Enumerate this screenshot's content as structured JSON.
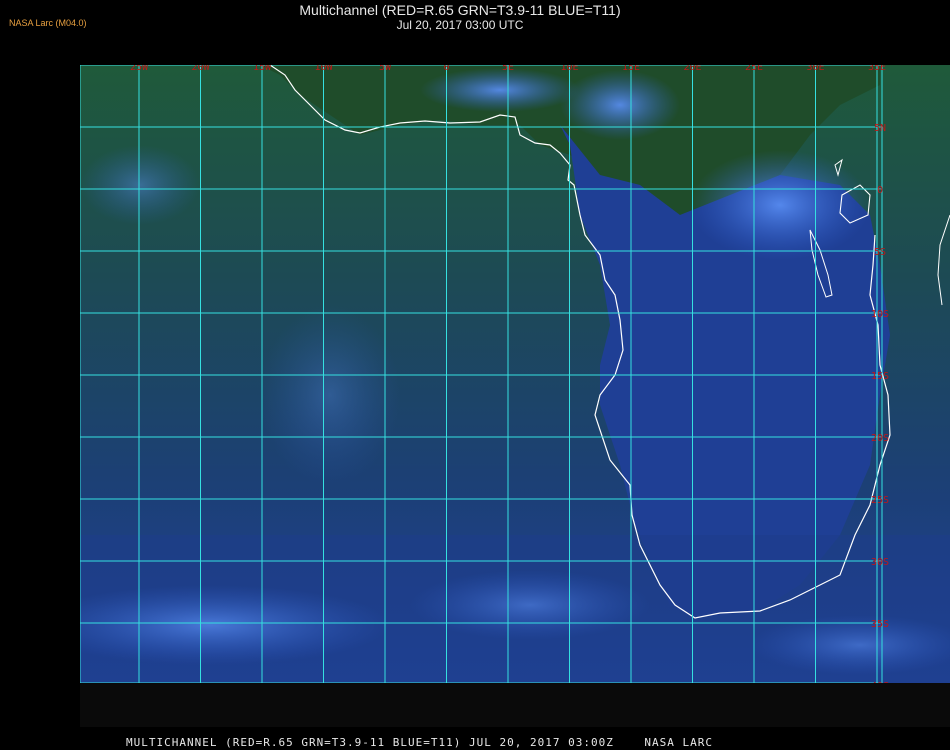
{
  "corner_label": "NASA Larc (M04.0)",
  "title": "Multichannel (RED=R.65 GRN=T3.9-11 BLUE=T11)",
  "subtitle": "Jul 20, 2017 03:00 UTC",
  "footer": "MULTICHANNEL (RED=R.65 GRN=T3.9-11 BLUE=T11) JUL 20, 2017 03:00Z    NASA LARC",
  "longitude_labels": [
    "25W",
    "20W",
    "15W",
    "10W",
    "5W",
    "0",
    "5E",
    "10E",
    "15E",
    "20E",
    "25E",
    "30E",
    "35E"
  ],
  "latitude_labels": [
    "5N",
    "0",
    "5S",
    "10S",
    "15S",
    "20S",
    "25S",
    "30S",
    "35S",
    "40S"
  ],
  "colors": {
    "grid": "#35e0e0",
    "label": "#c01818",
    "coast": "#ffffff",
    "ocean": "#1c4a7a",
    "land": "#1e4a28",
    "cloud": "#3a78e0"
  }
}
